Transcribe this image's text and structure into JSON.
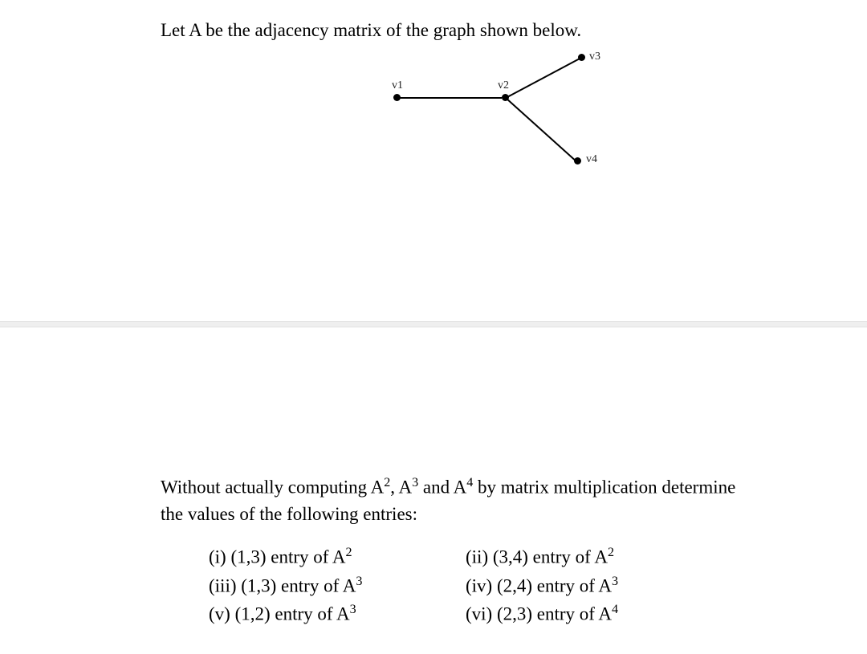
{
  "intro": "Let A be the adjacency matrix of the graph shown below.",
  "graph": {
    "v1": "v1",
    "v2": "v2",
    "v3": "v3",
    "v4": "v4"
  },
  "prompt_a": "Without actually computing A",
  "prompt_b": ", A",
  "prompt_c": " and A",
  "prompt_d": " by matrix multiplication determine the values of the following entries:",
  "sup2": "2",
  "sup3": "3",
  "sup4": "4",
  "entries": {
    "i": "(i) (1,3) entry of A",
    "ii": "(ii) (3,4) entry of A",
    "iii": "(iii) (1,3) entry of A",
    "iv": "(iv) (2,4) entry of A",
    "v": "(v) (1,2) entry of A",
    "vi": "(vi) (2,3) entry of A"
  }
}
